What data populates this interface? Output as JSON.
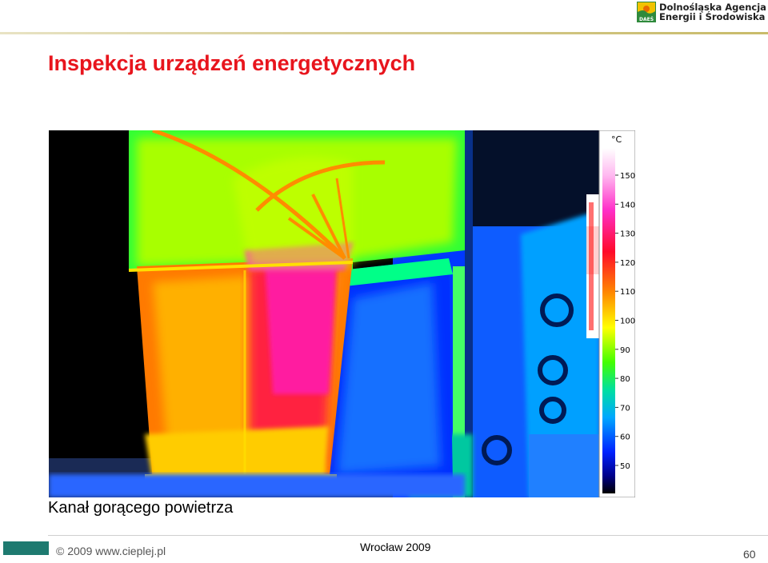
{
  "header": {
    "logo": {
      "line1": "Dolnośląska Agencja",
      "line2": "Energii i Środowiska",
      "mark_text": "DAEŚ"
    },
    "title": "Inspekcja urządzeń energetycznych"
  },
  "thermogram": {
    "unit": "°C",
    "scale_ticks": [
      "150",
      "140",
      "130",
      "120",
      "110",
      "100",
      "90",
      "80",
      "70",
      "60",
      "50"
    ],
    "palette": [
      "#ffffff",
      "#ff4fd0",
      "#ff0a3c",
      "#ff8a00",
      "#ffff00",
      "#66ff00",
      "#00e07a",
      "#00a0ff",
      "#0022ff",
      "#000066",
      "#000000"
    ]
  },
  "caption": "Kanał gorącego powietrza",
  "footer": {
    "copyright": "© 2009 www.cieplej.pl",
    "location": "Wrocław 2009",
    "page_number": "60"
  }
}
